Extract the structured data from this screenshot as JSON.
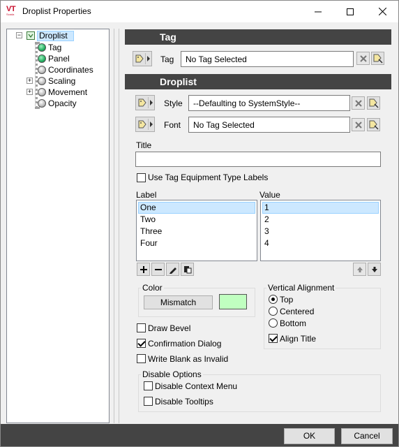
{
  "window": {
    "title": "Droplist Properties",
    "logo_text": "VT",
    "logo_sub": "Scada"
  },
  "tree": {
    "root": "Droplist",
    "items": [
      {
        "label": "Tag",
        "icon": "green-bullet-icon"
      },
      {
        "label": "Panel",
        "icon": "green-bullet-icon"
      },
      {
        "label": "Coordinates",
        "icon": "gray-bullet-icon"
      },
      {
        "label": "Scaling",
        "icon": "gray-bullet-icon",
        "expandable": true
      },
      {
        "label": "Movement",
        "icon": "gray-bullet-icon",
        "expandable": true
      },
      {
        "label": "Opacity",
        "icon": "gray-bullet-icon"
      }
    ]
  },
  "tag_section": {
    "header": "Tag",
    "tag_label": "Tag",
    "tag_value": "No Tag Selected"
  },
  "droplist_section": {
    "header": "Droplist",
    "style_label": "Style",
    "style_value": "--Defaulting to SystemStyle--",
    "font_label": "Font",
    "font_value": "No Tag Selected",
    "title_label": "Title",
    "title_value": "",
    "use_equipment_labels": "Use Tag Equipment Type Labels",
    "label_header": "Label",
    "value_header": "Value",
    "labels": [
      "One",
      "Two",
      "Three",
      "Four"
    ],
    "values": [
      "1",
      "2",
      "3",
      "4"
    ]
  },
  "color_group": {
    "title": "Color",
    "button": "Mismatch",
    "swatch_color": "#c0ffc0"
  },
  "valign_group": {
    "title": "Vertical Alignment",
    "options": [
      "Top",
      "Centered",
      "Bottom"
    ],
    "selected": "Top",
    "align_title": "Align Title"
  },
  "options": {
    "draw_bevel": "Draw Bevel",
    "confirmation_dialog": "Confirmation Dialog",
    "write_blank": "Write Blank as Invalid"
  },
  "disable_group": {
    "title": "Disable Options",
    "context_menu": "Disable Context Menu",
    "tooltips": "Disable Tooltips"
  },
  "footer": {
    "ok": "OK",
    "cancel": "Cancel"
  }
}
